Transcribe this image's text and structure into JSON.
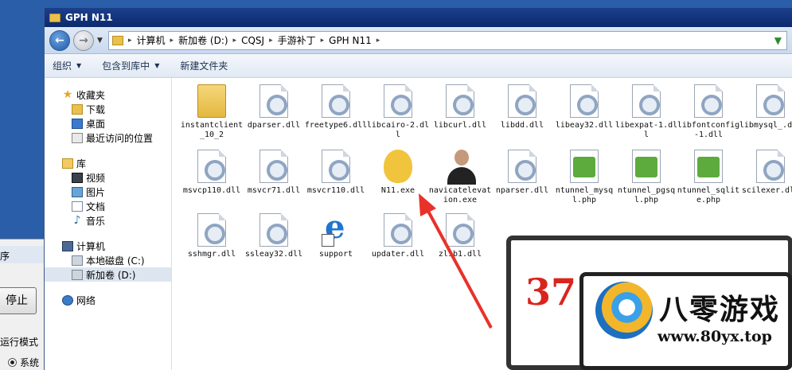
{
  "background_window": {
    "title_fragment": "序",
    "stop_button": "停止",
    "mode_label": "运行模式",
    "radio_label": "系统"
  },
  "window": {
    "title": "GPH N11"
  },
  "address": {
    "crumbs": [
      "计算机",
      "新加卷 (D:)",
      "CQSJ",
      "手游补丁",
      "GPH N11"
    ]
  },
  "toolbar": {
    "organize": "组织",
    "include_library": "包含到库中",
    "new_folder": "新建文件夹"
  },
  "nav": {
    "favorites": "收藏夹",
    "downloads": "下载",
    "desktop": "桌面",
    "recent": "最近访问的位置",
    "libraries": "库",
    "videos": "视频",
    "pictures": "图片",
    "documents": "文档",
    "music": "音乐",
    "computer": "计算机",
    "local_disk": "本地磁盘 (C:)",
    "new_volume": "新加卷 (D:)",
    "network": "网络"
  },
  "files": [
    {
      "name": "instantclient_10_2",
      "icon": "folder-icon"
    },
    {
      "name": "dparser.dll",
      "icon": "dll-icon"
    },
    {
      "name": "freetype6.dll",
      "icon": "dll-icon"
    },
    {
      "name": "libcairo-2.dll",
      "icon": "dll-icon"
    },
    {
      "name": "libcurl.dll",
      "icon": "dll-icon"
    },
    {
      "name": "libdd.dll",
      "icon": "dll-icon"
    },
    {
      "name": "libeay32.dll",
      "icon": "dll-icon"
    },
    {
      "name": "libexpat-1.dll",
      "icon": "dll-icon"
    },
    {
      "name": "libfontconfig-1.dll",
      "icon": "dll-icon"
    },
    {
      "name": "libmysql_.dll",
      "icon": "dll-icon"
    },
    {
      "name": "msvcp110.dll",
      "icon": "dll-icon"
    },
    {
      "name": "msvcr71.dll",
      "icon": "dll-icon"
    },
    {
      "name": "msvcr110.dll",
      "icon": "dll-icon"
    },
    {
      "name": "N11.exe",
      "icon": "app-icon"
    },
    {
      "name": "navicatelevation.exe",
      "icon": "person-icon"
    },
    {
      "name": "nparser.dll",
      "icon": "dll-icon"
    },
    {
      "name": "ntunnel_mysql.php",
      "icon": "php-icon"
    },
    {
      "name": "ntunnel_pgsql.php",
      "icon": "php-icon"
    },
    {
      "name": "ntunnel_sqlite.php",
      "icon": "php-icon"
    },
    {
      "name": "scilexer.dll",
      "icon": "dll-icon"
    },
    {
      "name": "sshmgr.dll",
      "icon": "dll-icon"
    },
    {
      "name": "ssleay32.dll",
      "icon": "dll-icon"
    },
    {
      "name": "support",
      "icon": "ie-shortcut-icon"
    },
    {
      "name": "updater.dll",
      "icon": "dll-icon"
    },
    {
      "name": "zlib1.dll",
      "icon": "dll-icon"
    }
  ],
  "watermark": {
    "number": "37",
    "brand": "八零游戏",
    "url": "www.80yx.top"
  },
  "colors": {
    "titlebar": "#0b2a6e",
    "arrow": "#e8322a",
    "accent": "#3a7ad0"
  }
}
